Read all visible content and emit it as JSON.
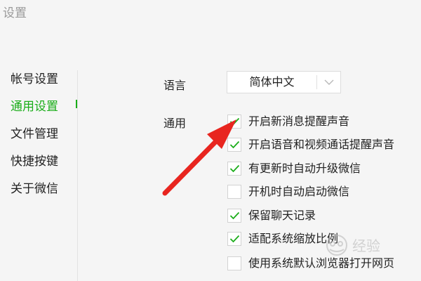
{
  "window": {
    "title": "设置"
  },
  "sidebar": {
    "items": [
      {
        "label": "帐号设置",
        "active": false
      },
      {
        "label": "通用设置",
        "active": true
      },
      {
        "label": "文件管理",
        "active": false
      },
      {
        "label": "快捷按键",
        "active": false
      },
      {
        "label": "关于微信",
        "active": false
      }
    ]
  },
  "settings": {
    "language": {
      "label": "语言",
      "value": "简体中文"
    },
    "general": {
      "label": "通用",
      "options": [
        {
          "label": "开启新消息提醒声音",
          "checked": true
        },
        {
          "label": "开启语音和视频通话提醒声音",
          "checked": true
        },
        {
          "label": "有更新时自动升级微信",
          "checked": true
        },
        {
          "label": "开机时自动启动微信",
          "checked": false
        },
        {
          "label": "保留聊天记录",
          "checked": true
        },
        {
          "label": "适配系统缩放比例",
          "checked": true
        },
        {
          "label": "使用系统默认浏览器打开网页",
          "checked": false
        }
      ]
    }
  },
  "annotation": {
    "arrow_color": "#e8251f"
  },
  "watermark": {
    "text": "经验"
  },
  "colors": {
    "accent": "#1aad19",
    "background": "#f5f5f5"
  }
}
